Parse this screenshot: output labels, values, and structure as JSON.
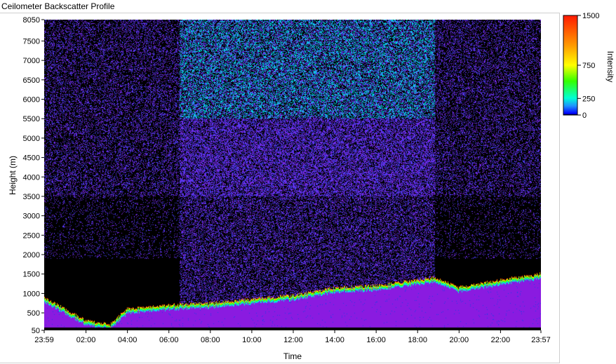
{
  "chart_data": {
    "type": "heatmap",
    "title": "Ceilometer Backscatter Profile",
    "xlabel": "Time",
    "ylabel": "Height (m)",
    "x_ticks": [
      "23:59",
      "02:00",
      "04:00",
      "06:00",
      "08:00",
      "10:00",
      "12:00",
      "14:00",
      "16:00",
      "18:00",
      "20:00",
      "22:00",
      "23:57"
    ],
    "y_ticks": [
      50,
      500,
      1000,
      1500,
      2000,
      2500,
      3000,
      3500,
      4000,
      4500,
      5000,
      5500,
      6000,
      6500,
      7000,
      7500,
      8050
    ],
    "ylim": [
      50,
      8050
    ],
    "colorbar": {
      "label": "Intensity",
      "ticks": [
        0,
        250,
        750,
        1500
      ],
      "range": [
        0,
        1500
      ]
    },
    "features": {
      "boundary_layer_top_m": [
        {
          "time": "23:59",
          "height": 900
        },
        {
          "time": "02:00",
          "height": 300
        },
        {
          "time": "03:10",
          "height": 200
        },
        {
          "time": "04:00",
          "height": 600
        },
        {
          "time": "06:00",
          "height": 700
        },
        {
          "time": "08:00",
          "height": 750
        },
        {
          "time": "10:00",
          "height": 850
        },
        {
          "time": "12:00",
          "height": 950
        },
        {
          "time": "14:00",
          "height": 1150
        },
        {
          "time": "16:00",
          "height": 1200
        },
        {
          "time": "18:00",
          "height": 1350
        },
        {
          "time": "18:50",
          "height": 1400
        },
        {
          "time": "20:00",
          "height": 1150
        },
        {
          "time": "22:00",
          "height": 1350
        },
        {
          "time": "23:57",
          "height": 1500
        }
      ],
      "noise_high_intensity_period": [
        "06:30",
        "18:50"
      ]
    },
    "colors": {
      "background": "#000000",
      "low": "#8a1be0",
      "mid": "#00e6e6",
      "high": "#ff2a00"
    }
  }
}
